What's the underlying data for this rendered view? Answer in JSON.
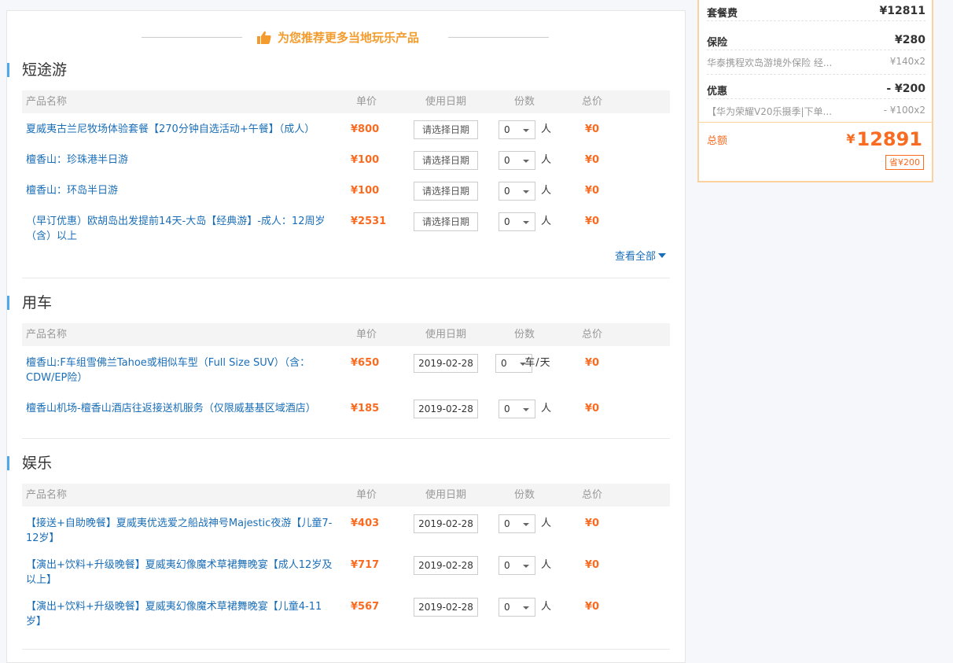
{
  "recommend": {
    "title": "为您推荐更多当地玩乐产品"
  },
  "table_headers": {
    "name": "产品名称",
    "price": "单价",
    "date": "使用日期",
    "qty": "份数",
    "total": "总价"
  },
  "sections": [
    {
      "title": "短途游",
      "rows": [
        {
          "name": "夏威夷古兰尼牧场体验套餐【270分钟自选活动+午餐】（成人）",
          "price": "¥800",
          "date": "请选择日期",
          "qty": "0",
          "unit": "人",
          "total": "¥0"
        },
        {
          "name": "檀香山：珍珠港半日游",
          "price": "¥100",
          "date": "请选择日期",
          "qty": "0",
          "unit": "人",
          "total": "¥0"
        },
        {
          "name": "檀香山：环岛半日游",
          "price": "¥100",
          "date": "请选择日期",
          "qty": "0",
          "unit": "人",
          "total": "¥0"
        },
        {
          "name": "（早订优惠）欧胡岛出发提前14天-大岛【经典游】-成人：12周岁（含）以上",
          "price": "¥2531",
          "date": "请选择日期",
          "qty": "0",
          "unit": "人",
          "total": "¥0"
        }
      ],
      "view_all": "查看全部"
    },
    {
      "title": "用车",
      "rows": [
        {
          "name": "檀香山:F车组雪佛兰Tahoe或相似车型（Full Size SUV）（含：CDW/EP险）",
          "price": "¥650",
          "date": "2019-02-28",
          "qty": "0",
          "unit": "车/天",
          "total": "¥0"
        },
        {
          "name": "檀香山机场-檀香山酒店往返接送机服务（仅限威基基区域酒店）",
          "price": "¥185",
          "date": "2019-02-28",
          "qty": "0",
          "unit": "人",
          "total": "¥0"
        }
      ]
    },
    {
      "title": "娱乐",
      "rows": [
        {
          "name": "【接送+自助晚餐】夏威夷优选爱之船战神号Majestic夜游【儿童7-12岁】",
          "price": "¥403",
          "date": "2019-02-28",
          "qty": "0",
          "unit": "人",
          "total": "¥0"
        },
        {
          "name": "【演出+饮料+升级晚餐】夏威夷幻像魔术草裙舞晚宴【成人12岁及以上】",
          "price": "¥717",
          "date": "2019-02-28",
          "qty": "0",
          "unit": "人",
          "total": "¥0"
        },
        {
          "name": "【演出+饮料+升级晚餐】夏威夷幻像魔术草裙舞晚宴【儿童4-11岁】",
          "price": "¥567",
          "date": "2019-02-28",
          "qty": "0",
          "unit": "人",
          "total": "¥0"
        }
      ]
    }
  ],
  "summary": {
    "package_label": "套餐费",
    "package_value": "¥12811",
    "insurance_label": "保险",
    "insurance_value": "¥280",
    "insurance_item": "华泰携程欢岛游境外保险 经...",
    "insurance_item_value": "¥140x2",
    "discount_label": "优惠",
    "discount_value": "- ¥200",
    "discount_item": "【华为荣耀V20乐摄季|下单...",
    "discount_item_value": "- ¥100x2",
    "total_label": "总额",
    "total_currency": "¥",
    "total_value": "12891",
    "save_badge": "省¥200"
  },
  "colors": {
    "accent": "#f86b20",
    "link": "#1a6eb7",
    "section_bar": "#4fa8e8",
    "recommend": "#f39c2d"
  },
  "icons": {
    "recommend": "thumbs-up-icon",
    "view_all": "caret-down-icon",
    "qty": "chevron-down-icon"
  }
}
